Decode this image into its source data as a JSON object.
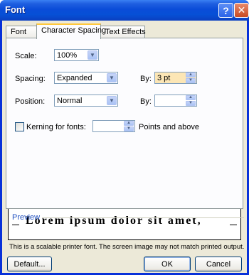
{
  "window": {
    "title": "Font",
    "help_label": "?",
    "close_label": "✕"
  },
  "tabs": [
    {
      "label": "Font",
      "mnemonic": "n",
      "active": false
    },
    {
      "label": "Character Spacing",
      "mnemonic": "r",
      "active": true
    },
    {
      "label": "Text Effects",
      "mnemonic": "x",
      "active": false
    }
  ],
  "fields": {
    "scale": {
      "label": "Scale:",
      "value": "100%"
    },
    "spacing": {
      "label": "Spacing:",
      "value": "Expanded"
    },
    "spacing_by": {
      "label": "By:",
      "value": "3 pt"
    },
    "position": {
      "label": "Position:",
      "value": "Normal"
    },
    "position_by": {
      "label": "By:",
      "value": ""
    },
    "kerning": {
      "label": "Kerning for fonts:",
      "checked": false,
      "value": "",
      "suffix": "Points and above"
    }
  },
  "preview": {
    "title": "Preview",
    "sample_text": "Lorem ipsum dolor sit amet,",
    "note": "This is a scalable printer font. The screen image may not match printed output."
  },
  "buttons": {
    "default": "Default...",
    "ok": "OK",
    "cancel": "Cancel"
  },
  "colors": {
    "title_bar": "#0a4cd8",
    "dialog_bg": "#ece9d8",
    "highlight_field": "#fce6b5",
    "preview_title": "#2050c0"
  }
}
